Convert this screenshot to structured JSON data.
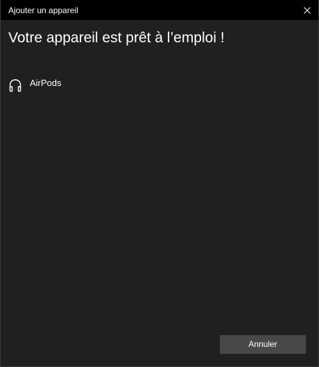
{
  "window": {
    "title": "Ajouter un appareil"
  },
  "main": {
    "heading": "Votre appareil est prêt à l’emploi !",
    "devices": [
      {
        "name": "AirPods",
        "icon": "headphones-icon"
      }
    ]
  },
  "footer": {
    "cancel_label": "Annuler"
  },
  "colors": {
    "background": "#202020",
    "titlebar": "#000000",
    "button": "#484848",
    "text": "#ffffff"
  }
}
